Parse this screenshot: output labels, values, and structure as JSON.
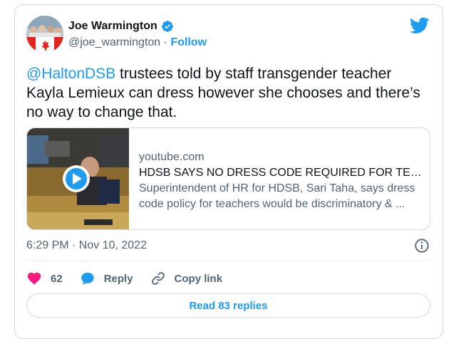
{
  "author": {
    "name": "Joe Warmington",
    "handle": "@joe_warmington",
    "separator": "·",
    "follow_label": "Follow"
  },
  "tweet": {
    "mention": "@HaltonDSB",
    "text": " trustees told by staff transgender teacher Kayla Lemieux can dress however she chooses and there’s no way to change that."
  },
  "link_card": {
    "domain": "youtube.com",
    "title": "HDSB SAYS NO DRESS CODE REQUIRED FOR TEACH...",
    "description": "Superintendent of HR for HDSB, Sari Taha, says dress code policy for teachers would be discriminatory & ..."
  },
  "timestamp": "6:29 PM · Nov 10, 2022",
  "actions": {
    "like_count": "62",
    "reply_label": "Reply",
    "copy_link_label": "Copy link"
  },
  "read_replies_label": "Read 83 replies",
  "colors": {
    "accent": "#1d9bf0",
    "like": "#f91880",
    "text": "#0f1419",
    "muted": "#536471",
    "border": "#cfd9de"
  }
}
